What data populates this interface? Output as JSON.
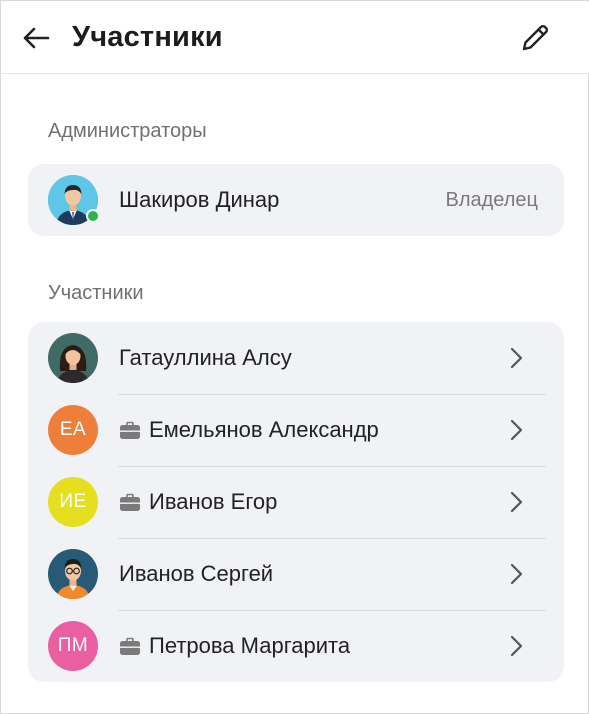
{
  "header": {
    "title": "Участники"
  },
  "admins": {
    "label": "Администраторы",
    "items": [
      {
        "name": "Шакиров Динар",
        "role": "Владелец"
      }
    ]
  },
  "members": {
    "label": "Участники",
    "items": [
      {
        "name": "Гатауллина Алсу"
      },
      {
        "name": "Емельянов Александр",
        "initials": "ЕА",
        "color": "#ee7f3b"
      },
      {
        "name": "Иванов Егор",
        "initials": "ИЕ",
        "color": "#e6df1f"
      },
      {
        "name": "Иванов Сергей"
      },
      {
        "name": "Петрова Маргарита",
        "initials": "ПМ",
        "color": "#ea5fa2"
      }
    ]
  },
  "colors": {
    "card_bg": "#f1f2f6",
    "online": "#2db54a",
    "muted_text": "#707070"
  }
}
